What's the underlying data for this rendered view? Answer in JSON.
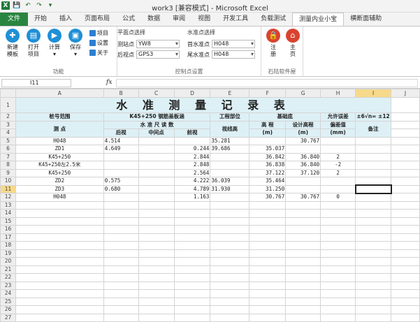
{
  "window": {
    "title": "work3 [兼容模式] - Microsoft Excel",
    "qat": [
      "X",
      "💾",
      "↶",
      "↷",
      "▾"
    ]
  },
  "tabs": [
    "文件",
    "开始",
    "插入",
    "页面布局",
    "公式",
    "数据",
    "审阅",
    "视图",
    "开发工具",
    "负载测试",
    "测量内业小宝",
    "横断面辅助"
  ],
  "ribbon": {
    "function_group": {
      "label": "功能",
      "buttons": [
        {
          "label": "新建\n模板",
          "icon": "new-template-icon"
        },
        {
          "label": "打开\n项目",
          "icon": "open-project-icon"
        },
        {
          "label": "计算\n▾",
          "icon": "calculate-icon"
        },
        {
          "label": "保存\n▾",
          "icon": "save-icon"
        }
      ],
      "small": [
        "项目",
        "设置",
        "关于"
      ]
    },
    "control_group": {
      "label": "控制点设置",
      "plane_head": "平面点选择",
      "level_head": "水准点选择",
      "fields": [
        {
          "label": "测站点",
          "value": "YW8"
        },
        {
          "label": "后视点",
          "value": "GPS3"
        },
        {
          "label": "首水准点",
          "value": "H048"
        },
        {
          "label": "尾水准点",
          "value": "H048"
        }
      ]
    },
    "shiluo_group": {
      "label": "石陆软件屋",
      "buttons": [
        "注\n册",
        "主\n页"
      ]
    }
  },
  "formula_bar": {
    "cell_ref": "I11",
    "fx": "fx",
    "value": ""
  },
  "sheet": {
    "columns": [
      "A",
      "B",
      "C",
      "D",
      "E",
      "F",
      "G",
      "H",
      "I",
      "J"
    ],
    "selected_col": "I",
    "selected_row": 11,
    "title": "水 准 测 量 记 录 表",
    "header_row2": {
      "a": "桩号范围",
      "bcd": "K45+250 钢筋盖板涵",
      "e": "工程部位",
      "fg": "基础底",
      "h": "允许误差",
      "i": "±6√n= ±12"
    },
    "header_row3": {
      "a": "测    点",
      "bcd": "水    准    尺    读    数",
      "e": "视线高",
      "f": "高    程",
      "g": "设计高程",
      "h": "偏差值",
      "i": "备注"
    },
    "header_row4": {
      "b": "后视",
      "c": "中间点",
      "d": "前视",
      "f": "(m)",
      "g": "(m)",
      "h": "(mm)"
    },
    "rows": [
      {
        "n": 5,
        "a": "H048",
        "b": "4.514",
        "c": "",
        "d": "",
        "e": "35.281",
        "f": "",
        "g": "30.767",
        "h": "",
        "i": ""
      },
      {
        "n": 6,
        "a": "ZD1",
        "b": "4.649",
        "c": "",
        "d": "0.244",
        "e": "39.686",
        "f": "35.037",
        "g": "",
        "h": "",
        "i": ""
      },
      {
        "n": 7,
        "a": "K45+250",
        "b": "",
        "c": "",
        "d": "2.844",
        "e": "",
        "f": "36.842",
        "g": "36.840",
        "h": "2",
        "i": ""
      },
      {
        "n": 8,
        "a": "K45+250左2.5米",
        "b": "",
        "c": "",
        "d": "2.848",
        "e": "",
        "f": "36.838",
        "g": "36.840",
        "h": "-2",
        "i": ""
      },
      {
        "n": 9,
        "a": "K45+250",
        "b": "",
        "c": "",
        "d": "2.564",
        "e": "",
        "f": "37.122",
        "g": "37.120",
        "h": "2",
        "i": ""
      },
      {
        "n": 10,
        "a": "ZD2",
        "b": "0.575",
        "c": "",
        "d": "4.222",
        "e": "36.039",
        "f": "35.464",
        "g": "",
        "h": "",
        "i": ""
      },
      {
        "n": 11,
        "a": "ZD3",
        "b": "0.680",
        "c": "",
        "d": "4.789",
        "e": "31.930",
        "f": "31.250",
        "g": "",
        "h": "",
        "i": ""
      },
      {
        "n": 12,
        "a": "H048",
        "b": "",
        "c": "",
        "d": "1.163",
        "e": "",
        "f": "30.767",
        "g": "30.767",
        "h": "0",
        "i": ""
      }
    ],
    "empty_rows": [
      13,
      14,
      15,
      16,
      17,
      18,
      19,
      20,
      21,
      22,
      23,
      24,
      25,
      26,
      27,
      28
    ]
  },
  "colors": {
    "file_tab": "#2a8540",
    "header_fill": "#ddf0f6",
    "selected_header": "#f7d98b",
    "ribbon_button": "#1f8fd6",
    "register_button": "#d9432f"
  }
}
